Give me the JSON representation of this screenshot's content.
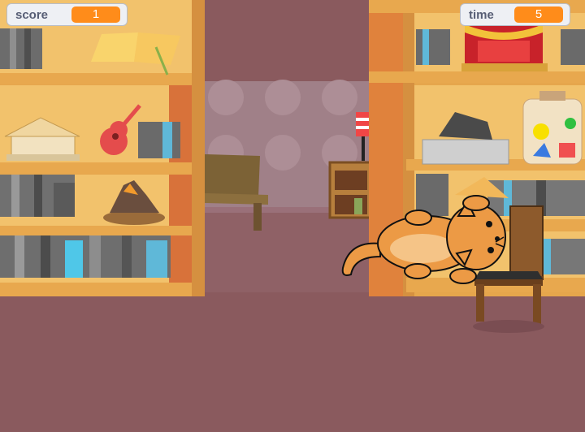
{
  "monitors": {
    "score": {
      "label": "score",
      "value": "1"
    },
    "time": {
      "label": "time",
      "value": "5"
    }
  },
  "colors": {
    "shelf": "#e5a44a",
    "shelf_edge": "#c58834",
    "wall_pink": "#a08088",
    "floor": "#8a5a5e",
    "monitor_value_bg": "#ff8c1a",
    "cat": "#ec9a45"
  },
  "sprites": [
    "cat",
    "chair",
    "bookshelves",
    "table",
    "lamp"
  ]
}
